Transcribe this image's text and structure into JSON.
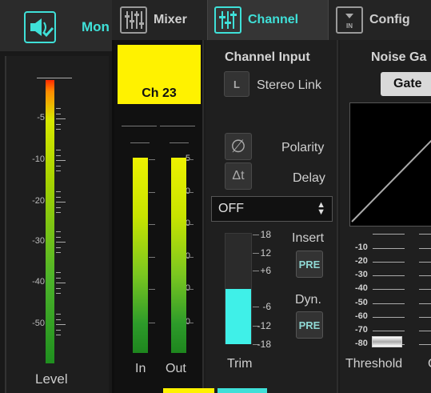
{
  "monitor": {
    "tab_label": "Mon",
    "meter_label": "Level",
    "scale": [
      "-5",
      "-10",
      "-20",
      "-30",
      "-40",
      "-50"
    ]
  },
  "tabs": [
    {
      "label": "Mixer",
      "icon": "mixer-faders-icon",
      "active": false
    },
    {
      "label": "Channel",
      "icon": "channel-sliders-icon",
      "active": true
    },
    {
      "label": "Config",
      "icon": "config-input-icon",
      "active": false
    }
  ],
  "channel": {
    "name": "Ch 23",
    "name_color": "#fff200",
    "meter_scale": [
      "-5",
      "-10",
      "-20",
      "-30",
      "-40",
      "-50"
    ],
    "in_label": "In",
    "out_label": "Out"
  },
  "input": {
    "title": "Channel Input",
    "stereo_link_btn": "L",
    "stereo_link_label": "Stereo Link",
    "polarity_label": "Polarity",
    "delay_btn": "Δt",
    "delay_label": "Delay",
    "delay_value": "OFF",
    "trim_label": "Trim",
    "trim_scale": [
      "18",
      "12",
      "+6",
      "-6",
      "-12",
      "-18"
    ],
    "trim_level": 0.5,
    "insert_label": "Insert",
    "insert_btn": "PRE",
    "dyn_label": "Dyn.",
    "dyn_btn": "PRE"
  },
  "gate": {
    "title": "Noise Ga",
    "toggle_label": "Gate",
    "threshold_label": "Threshold",
    "scale": [
      "-10",
      "-20",
      "-30",
      "-40",
      "-50",
      "-60",
      "-70",
      "-80"
    ],
    "edge_label": "C"
  },
  "colors": {
    "accent": "#3fe0d8",
    "trim_fill": "#3ff0e8"
  }
}
